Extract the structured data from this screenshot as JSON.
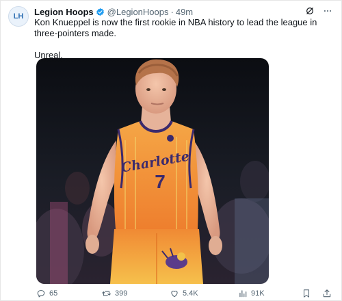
{
  "tweet": {
    "author": {
      "name": "Legion Hoops",
      "handle": "@LegionHoops",
      "avatar_text": "LH",
      "verified": true
    },
    "separator": "·",
    "time": "49m",
    "text": "Kon Knueppel is now the first rookie in NBA history to lead the league in three-pointers made.",
    "text2": "Unreal.",
    "media": {
      "jersey_wordmark": "Charlotte",
      "jersey_number": "7"
    },
    "actions": {
      "replies": "65",
      "reposts": "399",
      "likes": "5.4K",
      "views": "91K"
    },
    "icons": [
      "grok-icon",
      "more-icon",
      "reply-icon",
      "repost-icon",
      "like-icon",
      "views-icon",
      "bookmark-icon",
      "share-icon"
    ]
  },
  "colors": {
    "text": "#0f1419",
    "secondary": "#536471",
    "verified": "#1d9bf0",
    "jersey": "#f39a3e",
    "jersey_trim": "#3b2a6d"
  }
}
